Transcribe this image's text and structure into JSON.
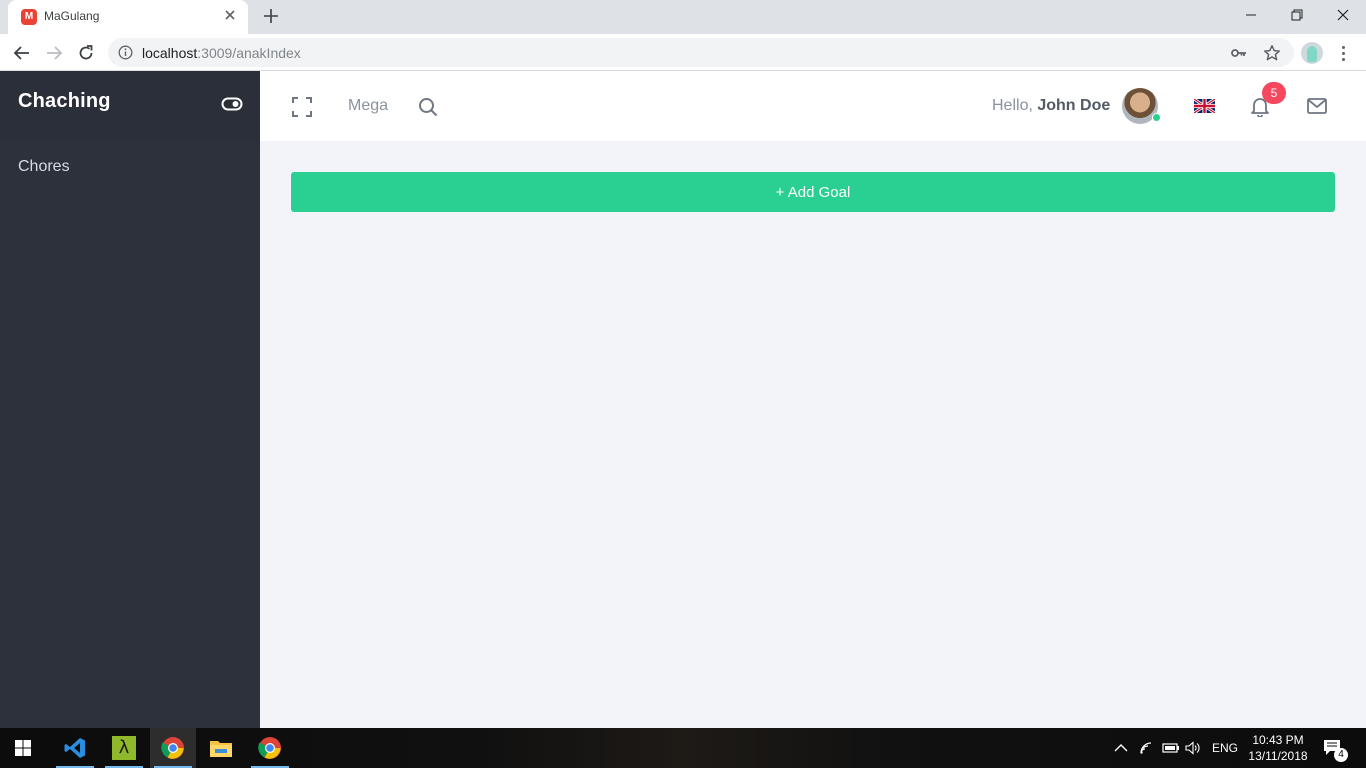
{
  "browser": {
    "tab_title": "MaGulang",
    "tab_favicon_letter": "M",
    "url_host": "localhost",
    "url_path": ":3009/anakIndex"
  },
  "sidebar": {
    "brand": "Chaching",
    "items": [
      {
        "label": "Chores"
      }
    ]
  },
  "topbar": {
    "mega_label": "Mega",
    "greeting": "Hello,",
    "user_name": "John Doe",
    "notification_count": "5"
  },
  "main": {
    "add_goal_label": "+ Add Goal"
  },
  "taskbar": {
    "language": "ENG",
    "time": "10:43 PM",
    "date": "13/11/2018",
    "notification_count": "4"
  },
  "colors": {
    "sidebar_bg": "#2c313c",
    "accent_green": "#29d091",
    "badge_red": "#f5475e",
    "main_bg": "#f3f4f9"
  }
}
